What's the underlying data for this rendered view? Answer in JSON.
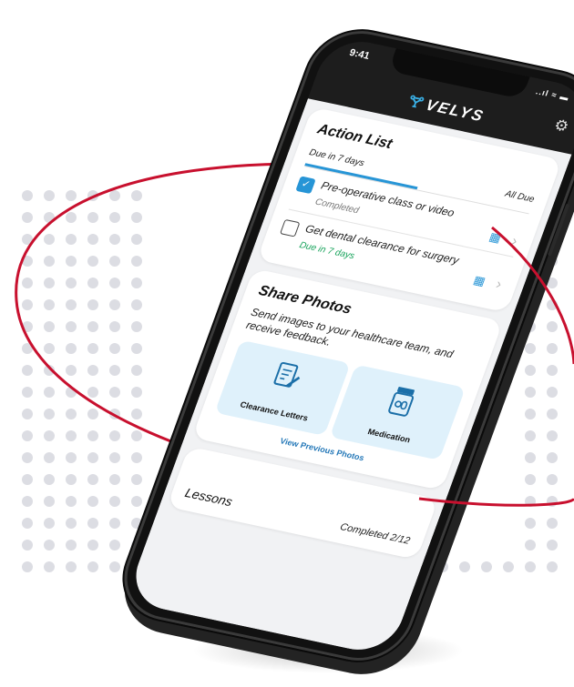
{
  "status_bar": {
    "time": "9:41",
    "signal_icon": "signal-wifi-battery-icon",
    "signal_text": "..ıl ≈ ▬"
  },
  "header": {
    "brand": "VELYS",
    "brand_mark": "🝖",
    "settings_icon": "gear-icon",
    "settings_glyph": "⚙"
  },
  "action_list": {
    "title": "Action List",
    "tabs": [
      {
        "label": "Due in 7 days",
        "active": true
      },
      {
        "label": "All Due",
        "active": false
      }
    ],
    "tasks": [
      {
        "name": "Pre-operative class or video",
        "status": "Completed",
        "checked": true
      },
      {
        "name": "Get dental clearance for surgery",
        "status": "Due in 7 days",
        "checked": false
      }
    ]
  },
  "share_photos": {
    "title": "Share Photos",
    "description": "Send images to your healthcare team, and receive feedback.",
    "tiles": [
      {
        "label": "Clearance Letters",
        "icon": "document-edit-icon"
      },
      {
        "label": "Medication",
        "icon": "pill-bottle-icon"
      }
    ],
    "link": "View Previous Photos"
  },
  "lessons": {
    "title": "Lessons",
    "progress": "Completed 2/12",
    "completed": 2,
    "total": 12
  },
  "colors": {
    "accent_blue": "#2795d6",
    "due_green": "#17a35b",
    "ring_red": "#c8102e",
    "tile_bg": "#dff1fb",
    "dots": "#dcdde3"
  }
}
